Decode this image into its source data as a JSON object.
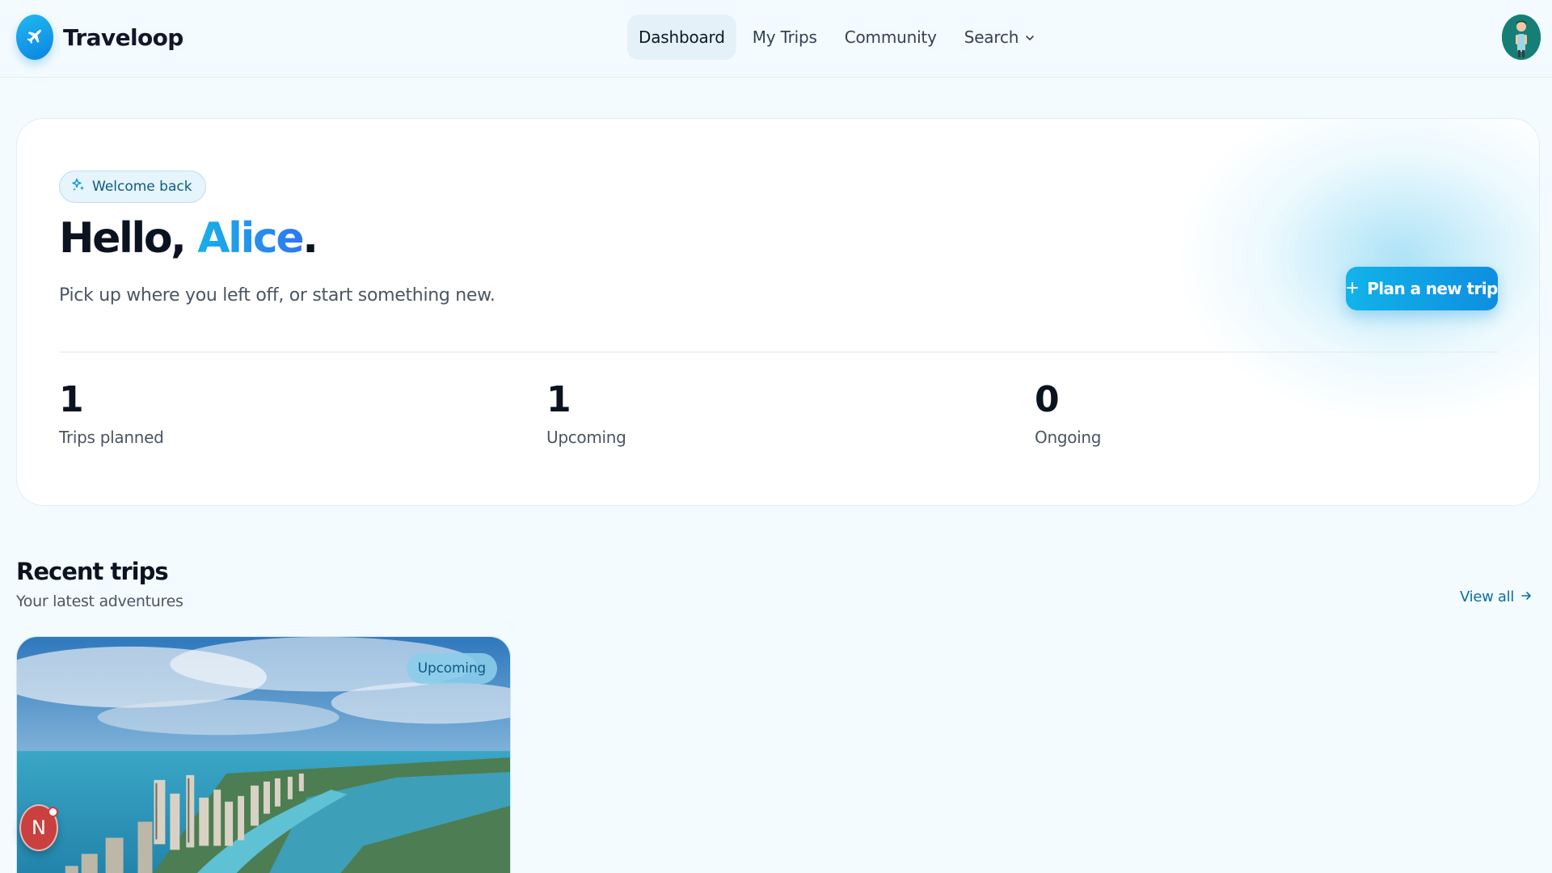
{
  "app": {
    "name": "Traveloop"
  },
  "nav": {
    "items": [
      {
        "label": "Dashboard",
        "active": true
      },
      {
        "label": "My Trips",
        "active": false
      },
      {
        "label": "Community",
        "active": false
      },
      {
        "label": "Search",
        "active": false,
        "has_dropdown": true
      }
    ]
  },
  "hero": {
    "welcome_label": "Welcome back",
    "greeting_prefix": "Hello, ",
    "user_name": "Alice",
    "greeting_suffix": ".",
    "subtitle": "Pick up where you left off, or start something new.",
    "cta_label": "Plan a new trip",
    "stats": [
      {
        "value": "1",
        "label": "Trips planned"
      },
      {
        "value": "1",
        "label": "Upcoming"
      },
      {
        "value": "0",
        "label": "Ongoing"
      }
    ]
  },
  "recent": {
    "title": "Recent trips",
    "subtitle": "Your latest adventures",
    "view_all_label": "View all",
    "trips": [
      {
        "status": "Upcoming"
      }
    ]
  },
  "floating_badge": {
    "letter": "N"
  },
  "colors": {
    "accent": "#12b3ea",
    "accent_dark": "#0e8ee0",
    "page_bg": "#f4fbfe",
    "badge_red": "#c9403f"
  },
  "icons": {
    "brand": "airplane-icon",
    "welcome": "sparkle-icon",
    "cta": "plus-icon",
    "search_dropdown": "chevron-down-icon",
    "view_all": "arrow-right-icon"
  }
}
